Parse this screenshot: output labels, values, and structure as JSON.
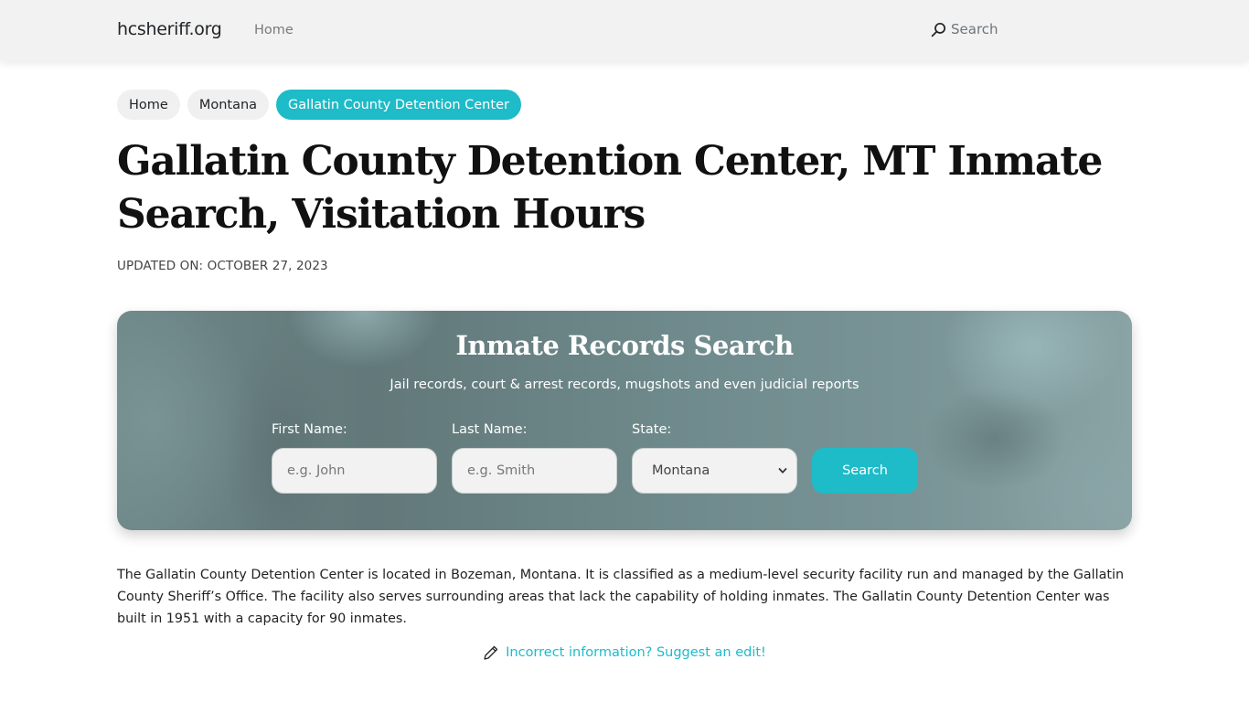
{
  "navbar": {
    "brand": "hcsheriff.org",
    "links": [
      {
        "label": "Home"
      }
    ],
    "search_label": "Search",
    "search_icon": "search-icon"
  },
  "breadcrumb": [
    {
      "label": "Home",
      "active": false
    },
    {
      "label": "Montana",
      "active": false
    },
    {
      "label": "Gallatin County Detention Center",
      "active": true
    }
  ],
  "page": {
    "title": "Gallatin County Detention Center, MT Inmate Search, Visitation Hours",
    "updated": "UPDATED ON: OCTOBER 27, 2023"
  },
  "search_card": {
    "title": "Inmate Records Search",
    "subtitle": "Jail records, court & arrest records, mugshots and even judicial reports",
    "first_name": {
      "label": "First Name:",
      "placeholder": "e.g. John",
      "value": ""
    },
    "last_name": {
      "label": "Last Name:",
      "placeholder": "e.g. Smith",
      "value": ""
    },
    "state": {
      "label": "State:",
      "selected": "Montana",
      "icon": "chevron-down-icon"
    },
    "search_button": "Search"
  },
  "content": {
    "description": "The Gallatin County Detention Center is located in Bozeman, Montana. It is classified as a medium-level security facility run and managed by the Gallatin County Sheriff’s Office. The facility also serves surrounding areas that lack the capability of holding inmates. The Gallatin County Detention Center was built in 1951 with a capacity for 90 inmates.",
    "suggest_edit": "Incorrect information? Suggest an edit!",
    "suggest_edit_icon": "pencil-icon"
  },
  "colors": {
    "accent": "#1ebbc8",
    "navbar_bg": "#f2f2f2",
    "crumb_bg": "#f0f0f0"
  }
}
